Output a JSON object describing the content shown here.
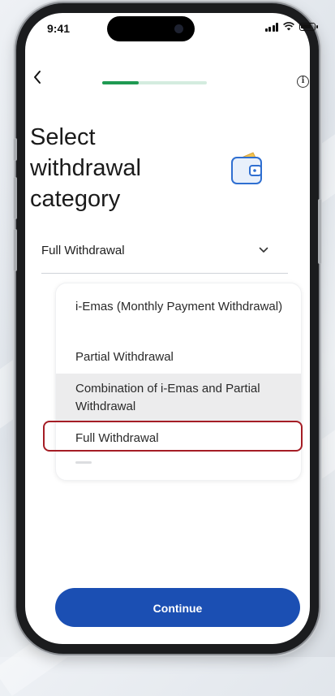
{
  "status_bar": {
    "time": "9:41"
  },
  "header": {
    "back_icon": "chevron-left-icon",
    "info_icon": "info-icon",
    "progress": 0.35
  },
  "page": {
    "title": "Select withdrawal category",
    "illustration_icon": "wallet-icon"
  },
  "category_select": {
    "selected_value": "Full Withdrawal",
    "chevron_icon": "chevron-down-icon",
    "options": [
      {
        "label": "i-Emas (Monthly Payment Withdrawal)"
      },
      {
        "label": "Partial Withdrawal"
      },
      {
        "label": "Combination of i-Emas and Partial Withdrawal"
      },
      {
        "label": "Full Withdrawal"
      }
    ]
  },
  "footer": {
    "continue_label": "Continue"
  },
  "colors": {
    "progress": "#1f9a52",
    "progress_track": "#d4ecdf",
    "primary_button": "#1b4fb3",
    "highlight_outline": "#a51d25",
    "option_highlight": "#ececed"
  }
}
